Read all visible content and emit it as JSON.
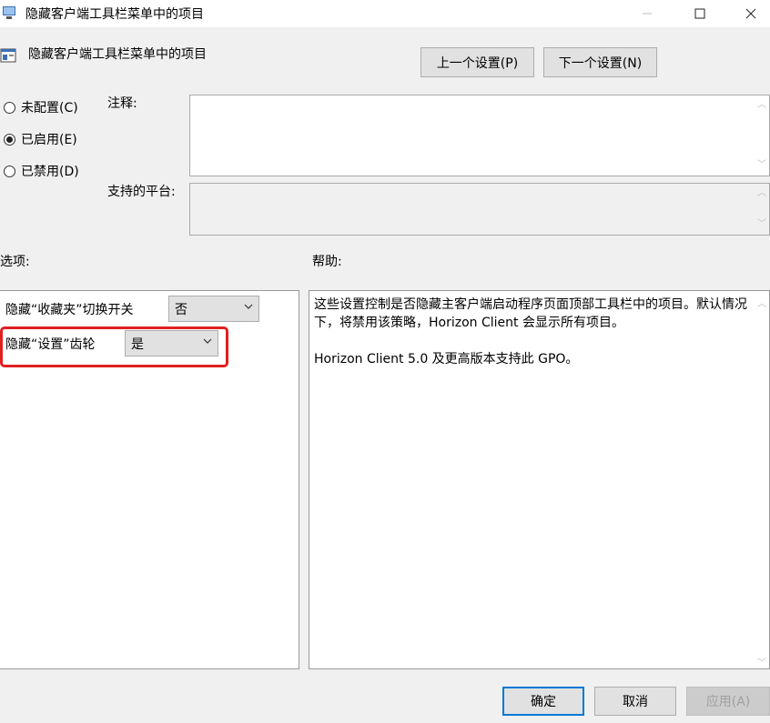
{
  "window": {
    "title": "隐藏客户端工具栏菜单中的项目"
  },
  "header": {
    "policy_name": "隐藏客户端工具栏菜单中的项目",
    "prev_label": "上一个设置(P)",
    "next_label": "下一个设置(N)"
  },
  "state": {
    "not_configured": "未配置(C)",
    "enabled": "已启用(E)",
    "disabled": "已禁用(D)",
    "selected": "enabled"
  },
  "comment_label": "注释:",
  "platform_label": "支持的平台:",
  "options": {
    "label": "选项:",
    "items": [
      {
        "label": "隐藏“收藏夹”切换开关",
        "value": "否"
      },
      {
        "label": "隐藏“设置”齿轮",
        "value": "是"
      }
    ]
  },
  "help": {
    "label": "帮助:",
    "p1": "这些设置控制是否隐藏主客户端启动程序页面顶部工具栏中的项目。默认情况下，将禁用该策略，Horizon Client 会显示所有项目。",
    "p2": "Horizon Client 5.0 及更高版本支持此 GPO。"
  },
  "footer": {
    "ok": "确定",
    "cancel": "取消",
    "apply": "应用(A)"
  },
  "colors": {
    "highlight": "#e02020",
    "focus": "#0078d7"
  }
}
